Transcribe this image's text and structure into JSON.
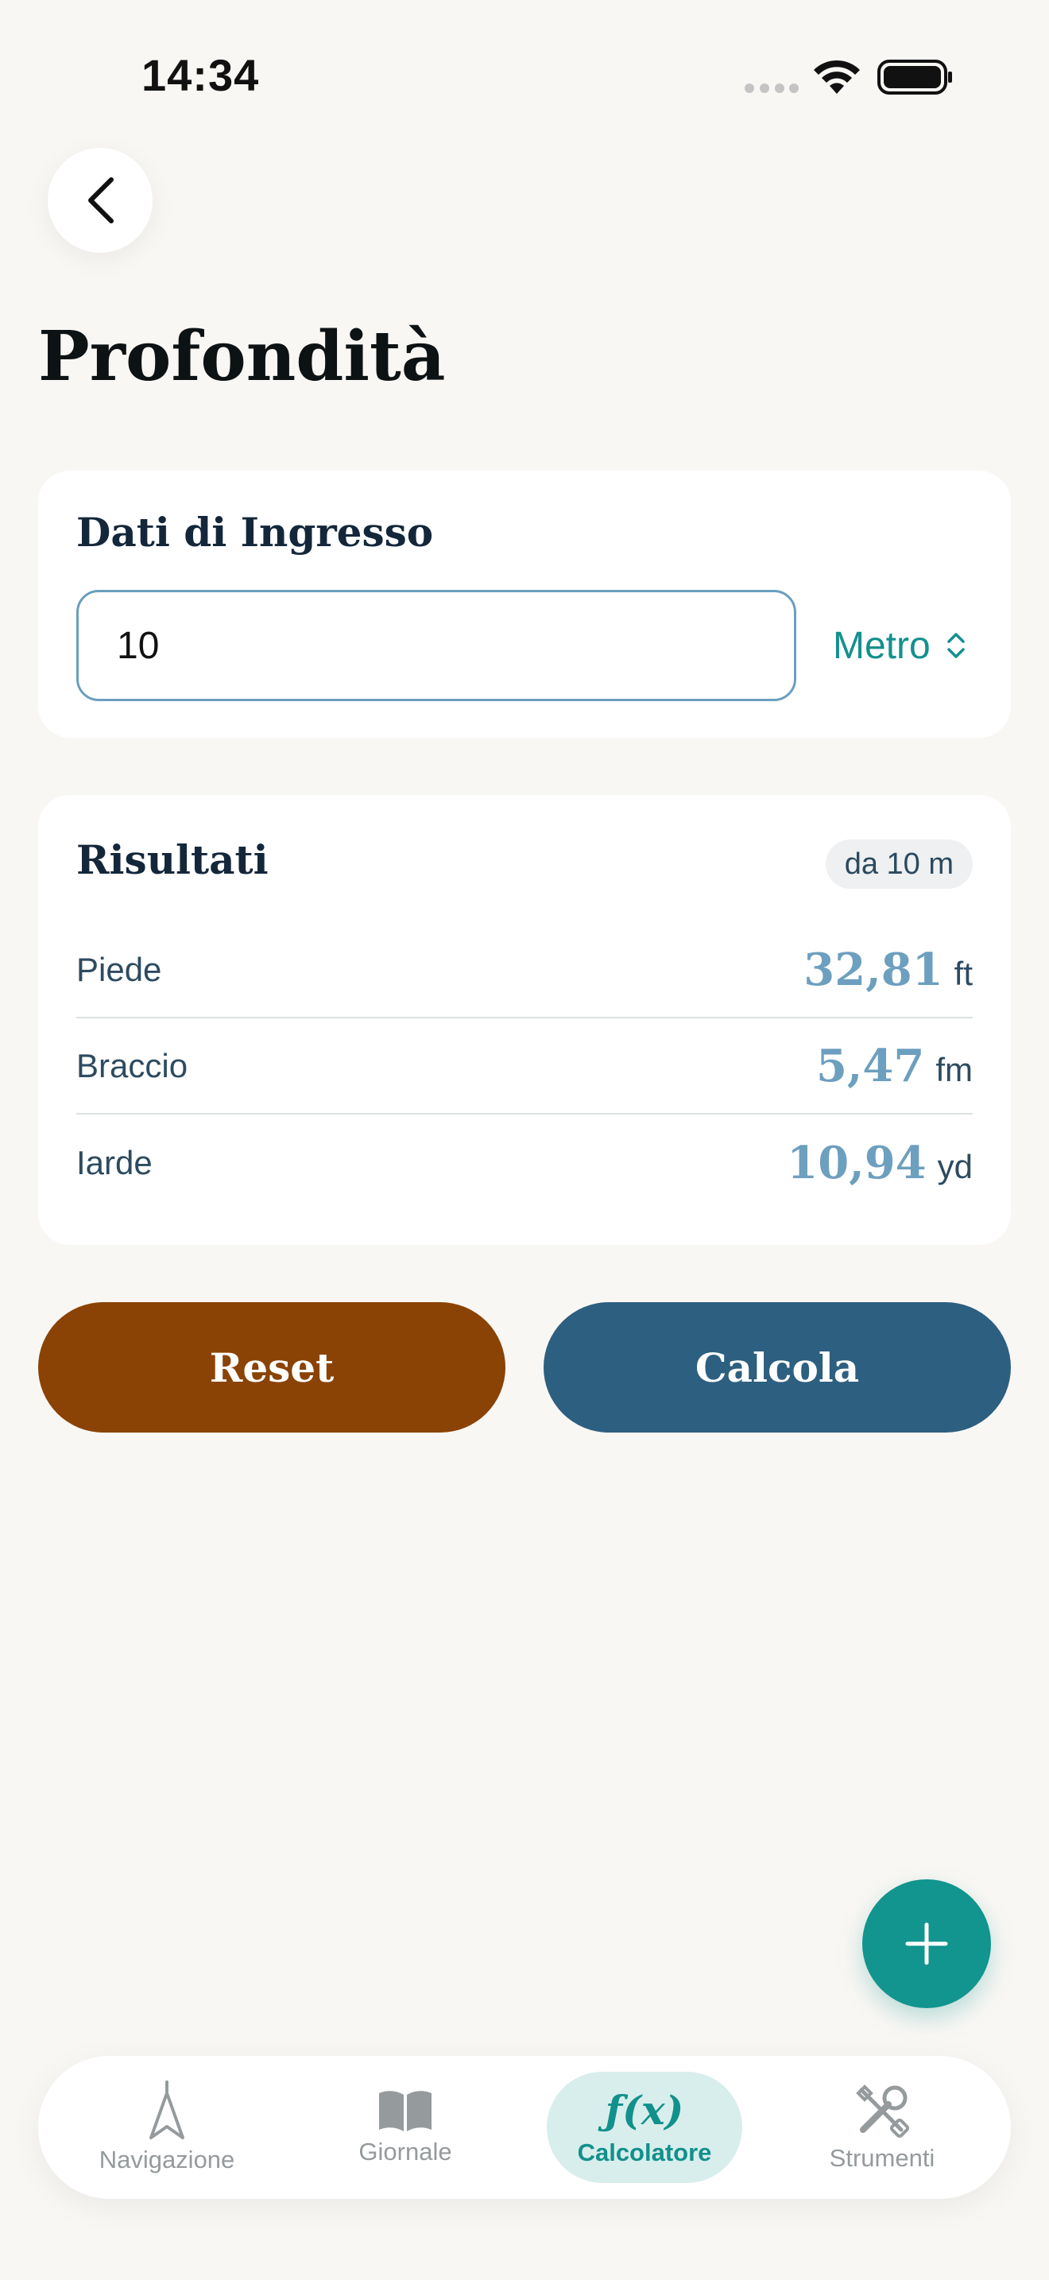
{
  "status_bar": {
    "time": "14:34"
  },
  "page": {
    "title": "Profondità"
  },
  "input_card": {
    "title": "Dati di Ingresso",
    "value": "10",
    "unit": "Metro"
  },
  "results_card": {
    "title": "Risultati",
    "source_badge": "da 10 m",
    "rows": [
      {
        "label": "Piede",
        "value": "32,81",
        "unit": "ft"
      },
      {
        "label": "Braccio",
        "value": "5,47",
        "unit": "fm"
      },
      {
        "label": "Iarde",
        "value": "10,94",
        "unit": "yd"
      }
    ]
  },
  "actions": {
    "reset_label": "Reset",
    "calculate_label": "Calcola"
  },
  "tab_bar": {
    "tabs": [
      {
        "label": "Navigazione",
        "icon": "compass-arrow-icon"
      },
      {
        "label": "Giornale",
        "icon": "book-icon"
      },
      {
        "label": "Calcolatore",
        "icon": "function-icon",
        "glyph": "ƒ(x)",
        "active": true
      },
      {
        "label": "Strumenti",
        "icon": "tools-icon"
      }
    ]
  },
  "colors": {
    "accent": "#12948f",
    "reset": "#8a4304",
    "calculate": "#2d5f80",
    "result_value": "#6d9fbf",
    "background": "#f9f7f4"
  }
}
